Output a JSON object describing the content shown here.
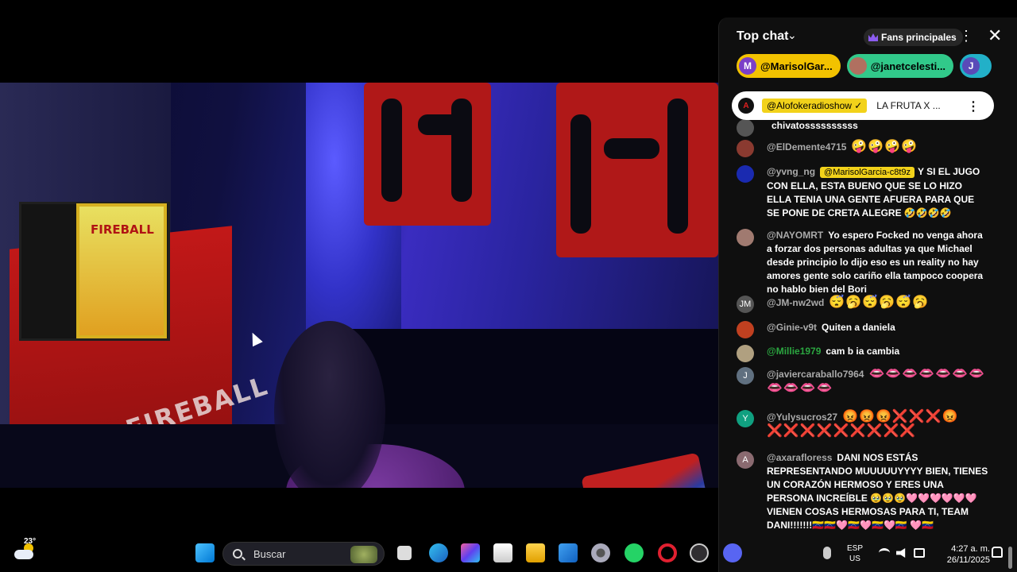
{
  "chat": {
    "title": "Top chat",
    "fans_label": "Fans principales",
    "chips": [
      {
        "initial": "M",
        "label": "@MarisolGar...",
        "bg": "#f2c200",
        "avatar_bg": "#7b3fc8"
      },
      {
        "initial": "",
        "label": "@janetcelesti...",
        "bg": "#31c98a",
        "avatar_bg": "#b07060"
      },
      {
        "initial": "J",
        "label": "",
        "bg": "#22b0c8",
        "avatar_bg": "#5a4ab8"
      }
    ],
    "pinned": {
      "handle": "@Alofokeradioshow ✓",
      "message": "LA FRUTA X ..."
    },
    "messages": [
      {
        "initial": "",
        "author": "",
        "text": "chivatossssssssss",
        "avatar_bg": "#555"
      },
      {
        "initial": "",
        "author": "@ElDemente4715",
        "text": "🤪🤪🤪🤪",
        "avatar_bg": "#8a3a30"
      },
      {
        "initial": "",
        "author": "@yvng_ng",
        "mention": "@MarisolGarcia-c8t9z",
        "text": "Y SI EL JUGO CON ELLA, ESTA BUENO QUE SE LO HIZO ELLA TENIA UNA GENTE AFUERA PARA QUE SE PONE DE CRETA ALEGRE 🤣🤣🤣🤣",
        "avatar_bg": "#1a2ab0"
      },
      {
        "initial": "",
        "author": "@NAYOMRT",
        "text": "Yo espero Focked no venga ahora a forzar dos personas adultas ya que Michael desde principio lo dijo eso es un reality no hay amores gente solo cariño ella tampoco coopera no hablo bien del Bori",
        "avatar_bg": "#a07a70"
      },
      {
        "initial": "JM",
        "author": "@JM-nw2wd",
        "text": "😴🥱😴🥱😴🥱",
        "avatar_bg": "#555"
      },
      {
        "initial": "",
        "author": "@Ginie-v9t",
        "text": "Quiten a daniela",
        "avatar_bg": "#c04020"
      },
      {
        "initial": "",
        "author": "@Millie1979",
        "text": "cam b ia cambia",
        "avatar_bg": "#b0a080"
      },
      {
        "initial": "J",
        "author": "@javiercaraballo7964",
        "text": "👄👄👄👄👄👄👄👄👄👄👄",
        "avatar_bg": "#607080"
      },
      {
        "initial": "Y",
        "author": "@Yulysucros27",
        "text": "😡😡😡❌❌❌😡❌❌❌❌❌❌❌❌❌",
        "avatar_bg": "#10a080"
      },
      {
        "initial": "A",
        "author": "@axarafloress",
        "text": "DANI NOS ESTÁS REPRESENTANDO MUUUUUYYYY BIEN, TIENES UN CORAZÓN HERMOSO Y ERES UNA PERSONA INCREÍBLE 🥹🥹🥹🩷🩷🩷🩷🩷🩷 VIENEN COSAS HERMOSAS PARA TI, TEAM DANI!!!!!!!🇻🇪🇻🇪🩷🇻🇪🩷🇻🇪🩷🇻🇪 🩷🇻🇪",
        "avatar_bg": "#8a6a70"
      }
    ]
  },
  "video": {
    "cabinet_text": "FIREBALL",
    "fridge_text": "FIREBALL"
  },
  "taskbar": {
    "temperature": "23°",
    "search_placeholder": "Buscar",
    "lang_line1": "ESP",
    "lang_line2": "US",
    "time": "4:27 a. m.",
    "date": "26/11/2025"
  },
  "colors": {
    "chat_bg": "#0f0f0f",
    "pinned_highlight": "#f2d21a",
    "member_green": "#2ba640"
  }
}
